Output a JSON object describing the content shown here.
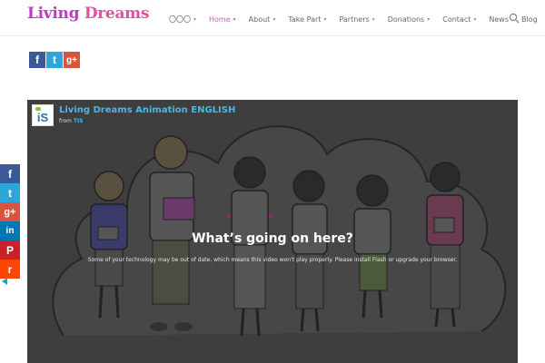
{
  "header": {
    "logo_word1": "Living",
    "logo_word2": "Dreams",
    "nav": [
      {
        "label": "〇〇〇",
        "dropdown": true
      },
      {
        "label": "Home",
        "dropdown": true,
        "active": true
      },
      {
        "label": "About",
        "dropdown": true
      },
      {
        "label": "Take Part",
        "dropdown": true
      },
      {
        "label": "Partners",
        "dropdown": true
      },
      {
        "label": "Donations",
        "dropdown": true
      },
      {
        "label": "Contact",
        "dropdown": true
      },
      {
        "label": "News",
        "dropdown": false
      },
      {
        "label": "Blog",
        "dropdown": false
      }
    ],
    "caret": "▾",
    "search_icon": "search-icon"
  },
  "share_row": {
    "facebook": "f",
    "twitter": "t",
    "googleplus": "g+"
  },
  "video": {
    "channel_logo": "iS",
    "title": "Living Dreams Animation ENGLISH",
    "from_prefix": "from",
    "channel": "TIS",
    "message_title": "What’s going on here?",
    "message_body": "Some of your technology may be out of date, which means this video won't play properly. Please install Flash or upgrade your browser."
  },
  "side_share": {
    "facebook": "f",
    "twitter": "t",
    "googleplus": "g+",
    "linkedin": "in",
    "pinterest": "P",
    "reddit": "r"
  },
  "colors": {
    "logo_word1": "#c437c8",
    "logo_word2": "#e64da3",
    "nav_active": "#c95fc0",
    "video_title": "#46b8ea",
    "facebook": "#3b5998",
    "twitter": "#2fa6d9",
    "googleplus": "#d8543f"
  }
}
